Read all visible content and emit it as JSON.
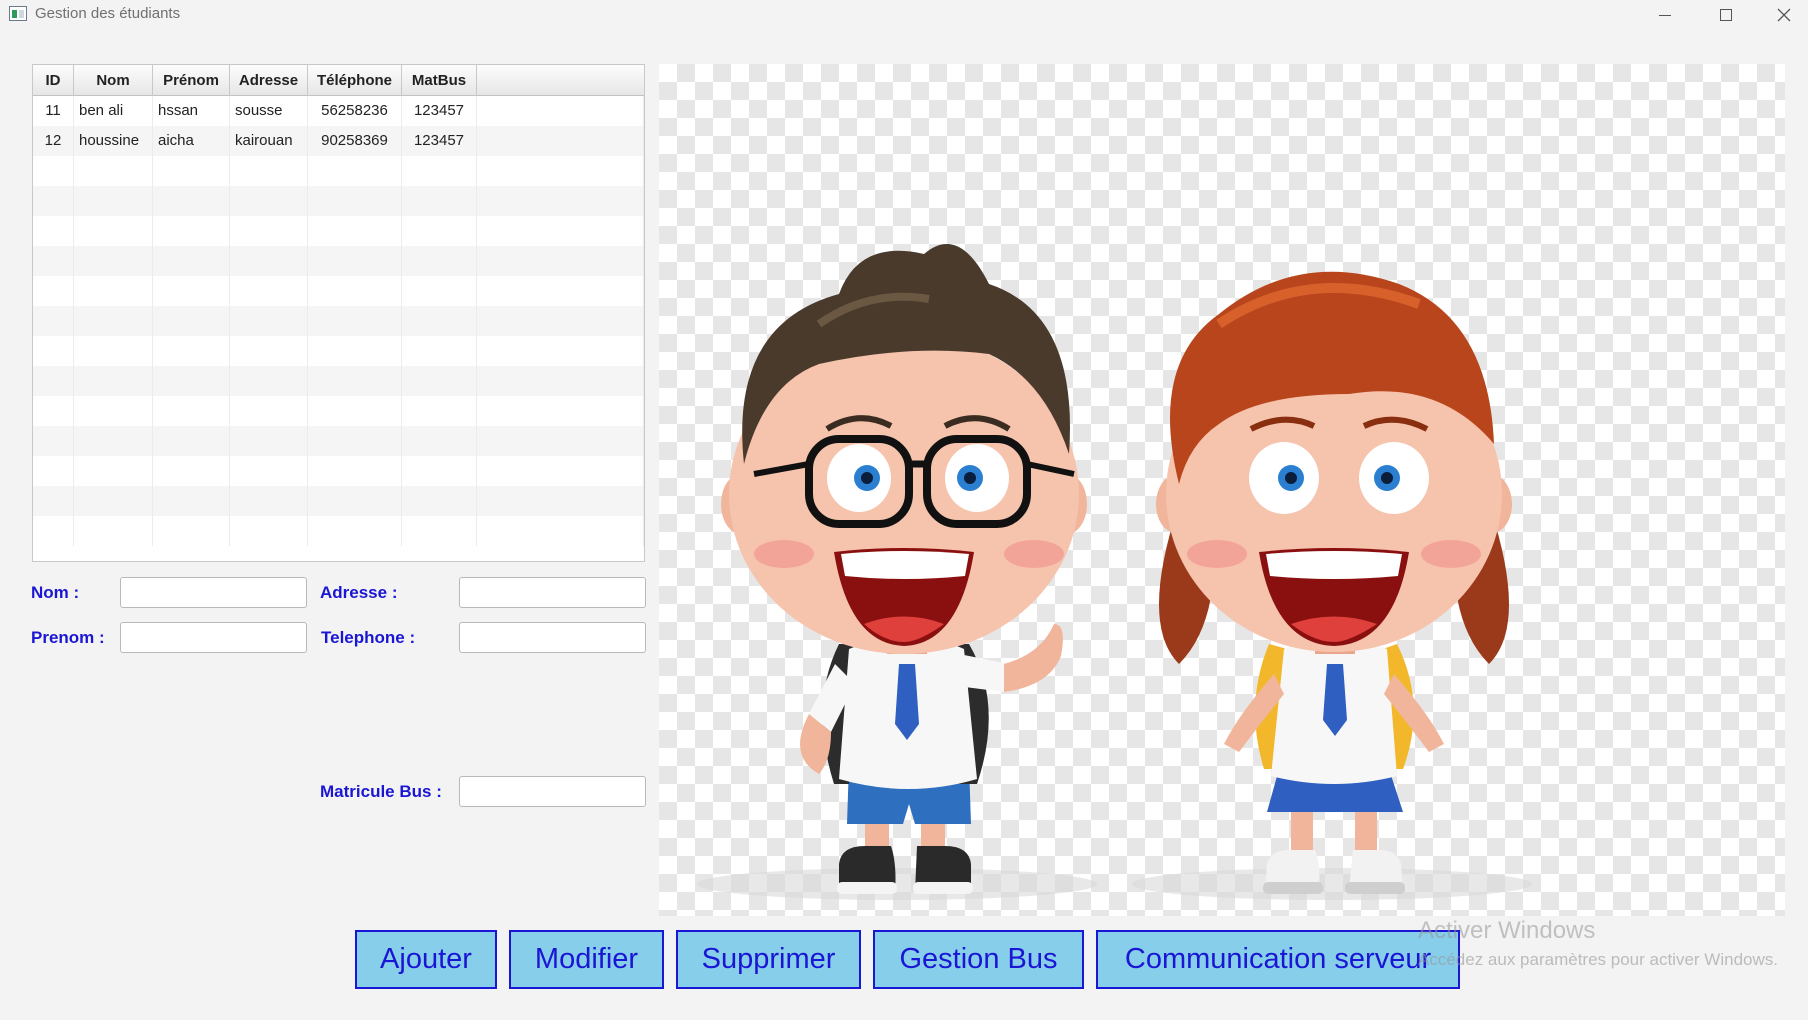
{
  "window": {
    "title": "Gestion des étudiants",
    "controls": [
      "minimize-icon",
      "maximize-icon",
      "close-icon"
    ]
  },
  "table": {
    "headers": [
      "ID",
      "Nom",
      "Prénom",
      "Adresse",
      "Téléphone",
      "MatBus"
    ],
    "rows": [
      [
        "11",
        "ben ali",
        "hssan",
        "sousse",
        "56258236",
        "123457"
      ],
      [
        "12",
        "houssine",
        "aicha",
        "kairouan",
        "90258369",
        "123457"
      ]
    ]
  },
  "form": {
    "nom_label": "Nom :",
    "nom_value": "",
    "prenom_label": "Prenom :",
    "prenom_value": "",
    "adresse_label": "Adresse :",
    "adresse_value": "",
    "telephone_label": "Telephone :",
    "telephone_value": "",
    "matricule_label": "Matricule Bus :",
    "matricule_value": ""
  },
  "buttons": {
    "ajouter": "Ajouter",
    "modifier": "Modifier",
    "supprimer": "Supprimer",
    "gestion_bus": "Gestion Bus",
    "communication": "Communication serveur"
  },
  "watermark": {
    "line1": "Activer Windows",
    "line2": "Accédez aux paramètres pour activer Windows."
  },
  "colors": {
    "label": "#1a16d4",
    "button_bg": "#87ceeb",
    "button_border": "#1a16d4"
  }
}
